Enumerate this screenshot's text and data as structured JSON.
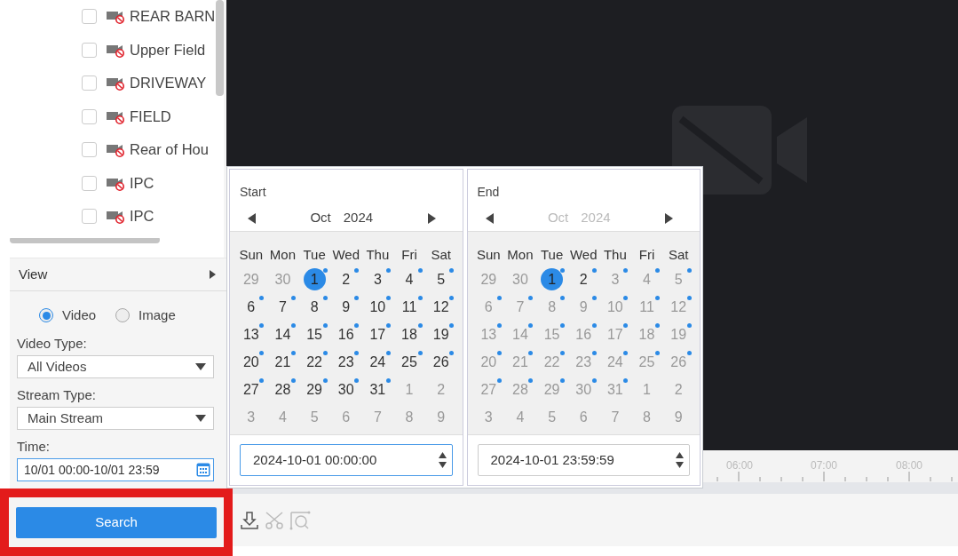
{
  "cameras": [
    {
      "label": "REAR BARN",
      "checked": false,
      "offline": true
    },
    {
      "label": "Upper Field",
      "checked": false,
      "offline": true
    },
    {
      "label": "DRIVEWAY",
      "checked": false,
      "offline": true
    },
    {
      "label": "FIELD",
      "checked": false,
      "offline": true
    },
    {
      "label": "Rear of Hou",
      "checked": false,
      "offline": true
    },
    {
      "label": "IPC",
      "checked": false,
      "offline": true
    },
    {
      "label": "IPC",
      "checked": false,
      "offline": true
    }
  ],
  "view": {
    "label": "View",
    "expanded": false
  },
  "media_options": [
    {
      "label": "Video",
      "selected": true
    },
    {
      "label": "Image",
      "selected": false
    }
  ],
  "video_type": {
    "label": "Video Type:",
    "value": "All Videos"
  },
  "stream_type": {
    "label": "Stream Type:",
    "value": "Main Stream"
  },
  "time": {
    "label": "Time:",
    "value": "10/01 00:00-10/01 23:59"
  },
  "search_button": "Search",
  "calendars": [
    {
      "title": "Start",
      "month": "Oct",
      "year": "2024",
      "header_muted": false,
      "weekdays": [
        "Sun",
        "Mon",
        "Tue",
        "Wed",
        "Thu",
        "Fri",
        "Sat"
      ],
      "time": "2024-10-01 00:00:00",
      "focused": true,
      "weeks": [
        [
          {
            "day": "29",
            "muted": true,
            "dot": false,
            "selected": false
          },
          {
            "day": "30",
            "muted": true,
            "dot": false,
            "selected": false
          },
          {
            "day": "1",
            "muted": false,
            "dot": true,
            "selected": true
          },
          {
            "day": "2",
            "muted": false,
            "dot": true,
            "selected": false
          },
          {
            "day": "3",
            "muted": false,
            "dot": true,
            "selected": false
          },
          {
            "day": "4",
            "muted": false,
            "dot": true,
            "selected": false
          },
          {
            "day": "5",
            "muted": false,
            "dot": true,
            "selected": false
          }
        ],
        [
          {
            "day": "6",
            "muted": false,
            "dot": true,
            "selected": false
          },
          {
            "day": "7",
            "muted": false,
            "dot": true,
            "selected": false
          },
          {
            "day": "8",
            "muted": false,
            "dot": true,
            "selected": false
          },
          {
            "day": "9",
            "muted": false,
            "dot": true,
            "selected": false
          },
          {
            "day": "10",
            "muted": false,
            "dot": true,
            "selected": false
          },
          {
            "day": "11",
            "muted": false,
            "dot": true,
            "selected": false
          },
          {
            "day": "12",
            "muted": false,
            "dot": true,
            "selected": false
          }
        ],
        [
          {
            "day": "13",
            "muted": false,
            "dot": true,
            "selected": false
          },
          {
            "day": "14",
            "muted": false,
            "dot": true,
            "selected": false
          },
          {
            "day": "15",
            "muted": false,
            "dot": true,
            "selected": false
          },
          {
            "day": "16",
            "muted": false,
            "dot": true,
            "selected": false
          },
          {
            "day": "17",
            "muted": false,
            "dot": true,
            "selected": false
          },
          {
            "day": "18",
            "muted": false,
            "dot": true,
            "selected": false
          },
          {
            "day": "19",
            "muted": false,
            "dot": true,
            "selected": false
          }
        ],
        [
          {
            "day": "20",
            "muted": false,
            "dot": true,
            "selected": false
          },
          {
            "day": "21",
            "muted": false,
            "dot": true,
            "selected": false
          },
          {
            "day": "22",
            "muted": false,
            "dot": true,
            "selected": false
          },
          {
            "day": "23",
            "muted": false,
            "dot": true,
            "selected": false
          },
          {
            "day": "24",
            "muted": false,
            "dot": true,
            "selected": false
          },
          {
            "day": "25",
            "muted": false,
            "dot": true,
            "selected": false
          },
          {
            "day": "26",
            "muted": false,
            "dot": true,
            "selected": false
          }
        ],
        [
          {
            "day": "27",
            "muted": false,
            "dot": true,
            "selected": false
          },
          {
            "day": "28",
            "muted": false,
            "dot": true,
            "selected": false
          },
          {
            "day": "29",
            "muted": false,
            "dot": true,
            "selected": false
          },
          {
            "day": "30",
            "muted": false,
            "dot": true,
            "selected": false
          },
          {
            "day": "31",
            "muted": false,
            "dot": true,
            "selected": false
          },
          {
            "day": "1",
            "muted": true,
            "dot": false,
            "selected": false
          },
          {
            "day": "2",
            "muted": true,
            "dot": false,
            "selected": false
          }
        ],
        [
          {
            "day": "3",
            "muted": true,
            "dot": false,
            "selected": false
          },
          {
            "day": "4",
            "muted": true,
            "dot": false,
            "selected": false
          },
          {
            "day": "5",
            "muted": true,
            "dot": false,
            "selected": false
          },
          {
            "day": "6",
            "muted": true,
            "dot": false,
            "selected": false
          },
          {
            "day": "7",
            "muted": true,
            "dot": false,
            "selected": false
          },
          {
            "day": "8",
            "muted": true,
            "dot": false,
            "selected": false
          },
          {
            "day": "9",
            "muted": true,
            "dot": false,
            "selected": false
          }
        ]
      ]
    },
    {
      "title": "End",
      "month": "Oct",
      "year": "2024",
      "header_muted": true,
      "weekdays": [
        "Sun",
        "Mon",
        "Tue",
        "Wed",
        "Thu",
        "Fri",
        "Sat"
      ],
      "time": "2024-10-01 23:59:59",
      "focused": false,
      "weeks": [
        [
          {
            "day": "29",
            "muted": true,
            "dot": false,
            "selected": false
          },
          {
            "day": "30",
            "muted": true,
            "dot": false,
            "selected": false
          },
          {
            "day": "1",
            "muted": false,
            "dot": true,
            "selected": true
          },
          {
            "day": "2",
            "muted": false,
            "dot": true,
            "selected": false
          },
          {
            "day": "3",
            "muted": true,
            "dot": true,
            "selected": false
          },
          {
            "day": "4",
            "muted": true,
            "dot": true,
            "selected": false
          },
          {
            "day": "5",
            "muted": true,
            "dot": true,
            "selected": false
          }
        ],
        [
          {
            "day": "6",
            "muted": true,
            "dot": true,
            "selected": false
          },
          {
            "day": "7",
            "muted": true,
            "dot": true,
            "selected": false
          },
          {
            "day": "8",
            "muted": true,
            "dot": true,
            "selected": false
          },
          {
            "day": "9",
            "muted": true,
            "dot": true,
            "selected": false
          },
          {
            "day": "10",
            "muted": true,
            "dot": true,
            "selected": false
          },
          {
            "day": "11",
            "muted": true,
            "dot": true,
            "selected": false
          },
          {
            "day": "12",
            "muted": true,
            "dot": true,
            "selected": false
          }
        ],
        [
          {
            "day": "13",
            "muted": true,
            "dot": true,
            "selected": false
          },
          {
            "day": "14",
            "muted": true,
            "dot": true,
            "selected": false
          },
          {
            "day": "15",
            "muted": true,
            "dot": true,
            "selected": false
          },
          {
            "day": "16",
            "muted": true,
            "dot": true,
            "selected": false
          },
          {
            "day": "17",
            "muted": true,
            "dot": true,
            "selected": false
          },
          {
            "day": "18",
            "muted": true,
            "dot": true,
            "selected": false
          },
          {
            "day": "19",
            "muted": true,
            "dot": true,
            "selected": false
          }
        ],
        [
          {
            "day": "20",
            "muted": true,
            "dot": true,
            "selected": false
          },
          {
            "day": "21",
            "muted": true,
            "dot": true,
            "selected": false
          },
          {
            "day": "22",
            "muted": true,
            "dot": true,
            "selected": false
          },
          {
            "day": "23",
            "muted": true,
            "dot": true,
            "selected": false
          },
          {
            "day": "24",
            "muted": true,
            "dot": true,
            "selected": false
          },
          {
            "day": "25",
            "muted": true,
            "dot": true,
            "selected": false
          },
          {
            "day": "26",
            "muted": true,
            "dot": true,
            "selected": false
          }
        ],
        [
          {
            "day": "27",
            "muted": true,
            "dot": true,
            "selected": false
          },
          {
            "day": "28",
            "muted": true,
            "dot": true,
            "selected": false
          },
          {
            "day": "29",
            "muted": true,
            "dot": true,
            "selected": false
          },
          {
            "day": "30",
            "muted": true,
            "dot": true,
            "selected": false
          },
          {
            "day": "31",
            "muted": true,
            "dot": true,
            "selected": false
          },
          {
            "day": "1",
            "muted": true,
            "dot": false,
            "selected": false
          },
          {
            "day": "2",
            "muted": true,
            "dot": false,
            "selected": false
          }
        ],
        [
          {
            "day": "3",
            "muted": true,
            "dot": false,
            "selected": false
          },
          {
            "day": "4",
            "muted": true,
            "dot": false,
            "selected": false
          },
          {
            "day": "5",
            "muted": true,
            "dot": false,
            "selected": false
          },
          {
            "day": "6",
            "muted": true,
            "dot": false,
            "selected": false
          },
          {
            "day": "7",
            "muted": true,
            "dot": false,
            "selected": false
          },
          {
            "day": "8",
            "muted": true,
            "dot": false,
            "selected": false
          },
          {
            "day": "9",
            "muted": true,
            "dot": false,
            "selected": false
          }
        ]
      ]
    }
  ],
  "timeline": {
    "labels": [
      "06:00",
      "07:00",
      "08:00"
    ]
  }
}
